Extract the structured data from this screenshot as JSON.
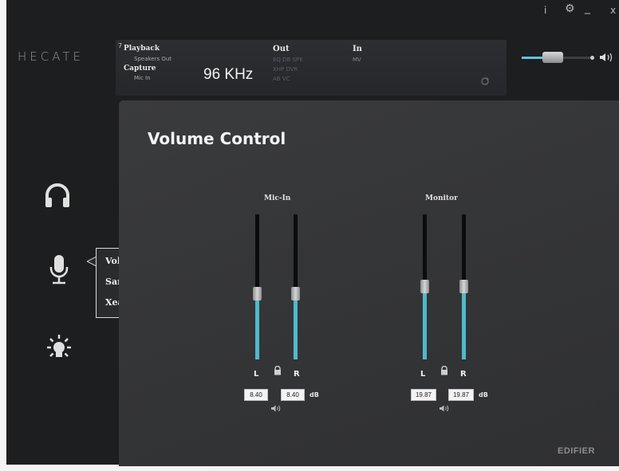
{
  "window": {
    "info_glyph": "i",
    "gear_glyph": "⚙",
    "minimize_glyph": "_",
    "close_glyph": "x"
  },
  "brand": {
    "name": "HECATE"
  },
  "status": {
    "channel_number": "7",
    "playback_label": "Playback",
    "playback_device": "Speakers Out",
    "capture_label": "Capture",
    "capture_device": "Mic In",
    "sample_rate": "96 KHz",
    "out_label": "Out",
    "out_effects_row1": "EQ  DB  SPK",
    "out_effects_row2": "XHP  DVR",
    "out_effects_row3": "AB  VC",
    "in_label": "In",
    "in_effect": "MV"
  },
  "master_volume": {
    "level": 0.42
  },
  "sidebar": {
    "items": [
      {
        "icon": "headphones-icon"
      },
      {
        "icon": "microphone-icon"
      },
      {
        "icon": "light-effects-icon"
      }
    ]
  },
  "popup_menu": {
    "items": [
      "Volume Control",
      "Sample Rate",
      "Xear Magic Voice"
    ]
  },
  "panel": {
    "title": "Volume Control",
    "groups": [
      {
        "label": "Mic-In",
        "left_label": "L",
        "right_label": "R",
        "left_db": "8.40",
        "right_db": "8.40",
        "unit": "dB",
        "left_level": 0.45,
        "right_level": 0.45
      },
      {
        "label": "Monitor",
        "left_label": "L",
        "right_label": "R",
        "left_db": "19.87",
        "right_db": "19.87",
        "unit": "dB",
        "left_level": 0.5,
        "right_level": 0.5
      }
    ]
  },
  "footer": {
    "brand": "EDIFIER"
  },
  "colors": {
    "accent": "#4fb9cc",
    "panel": "#363739",
    "background": "#1d1e20"
  }
}
